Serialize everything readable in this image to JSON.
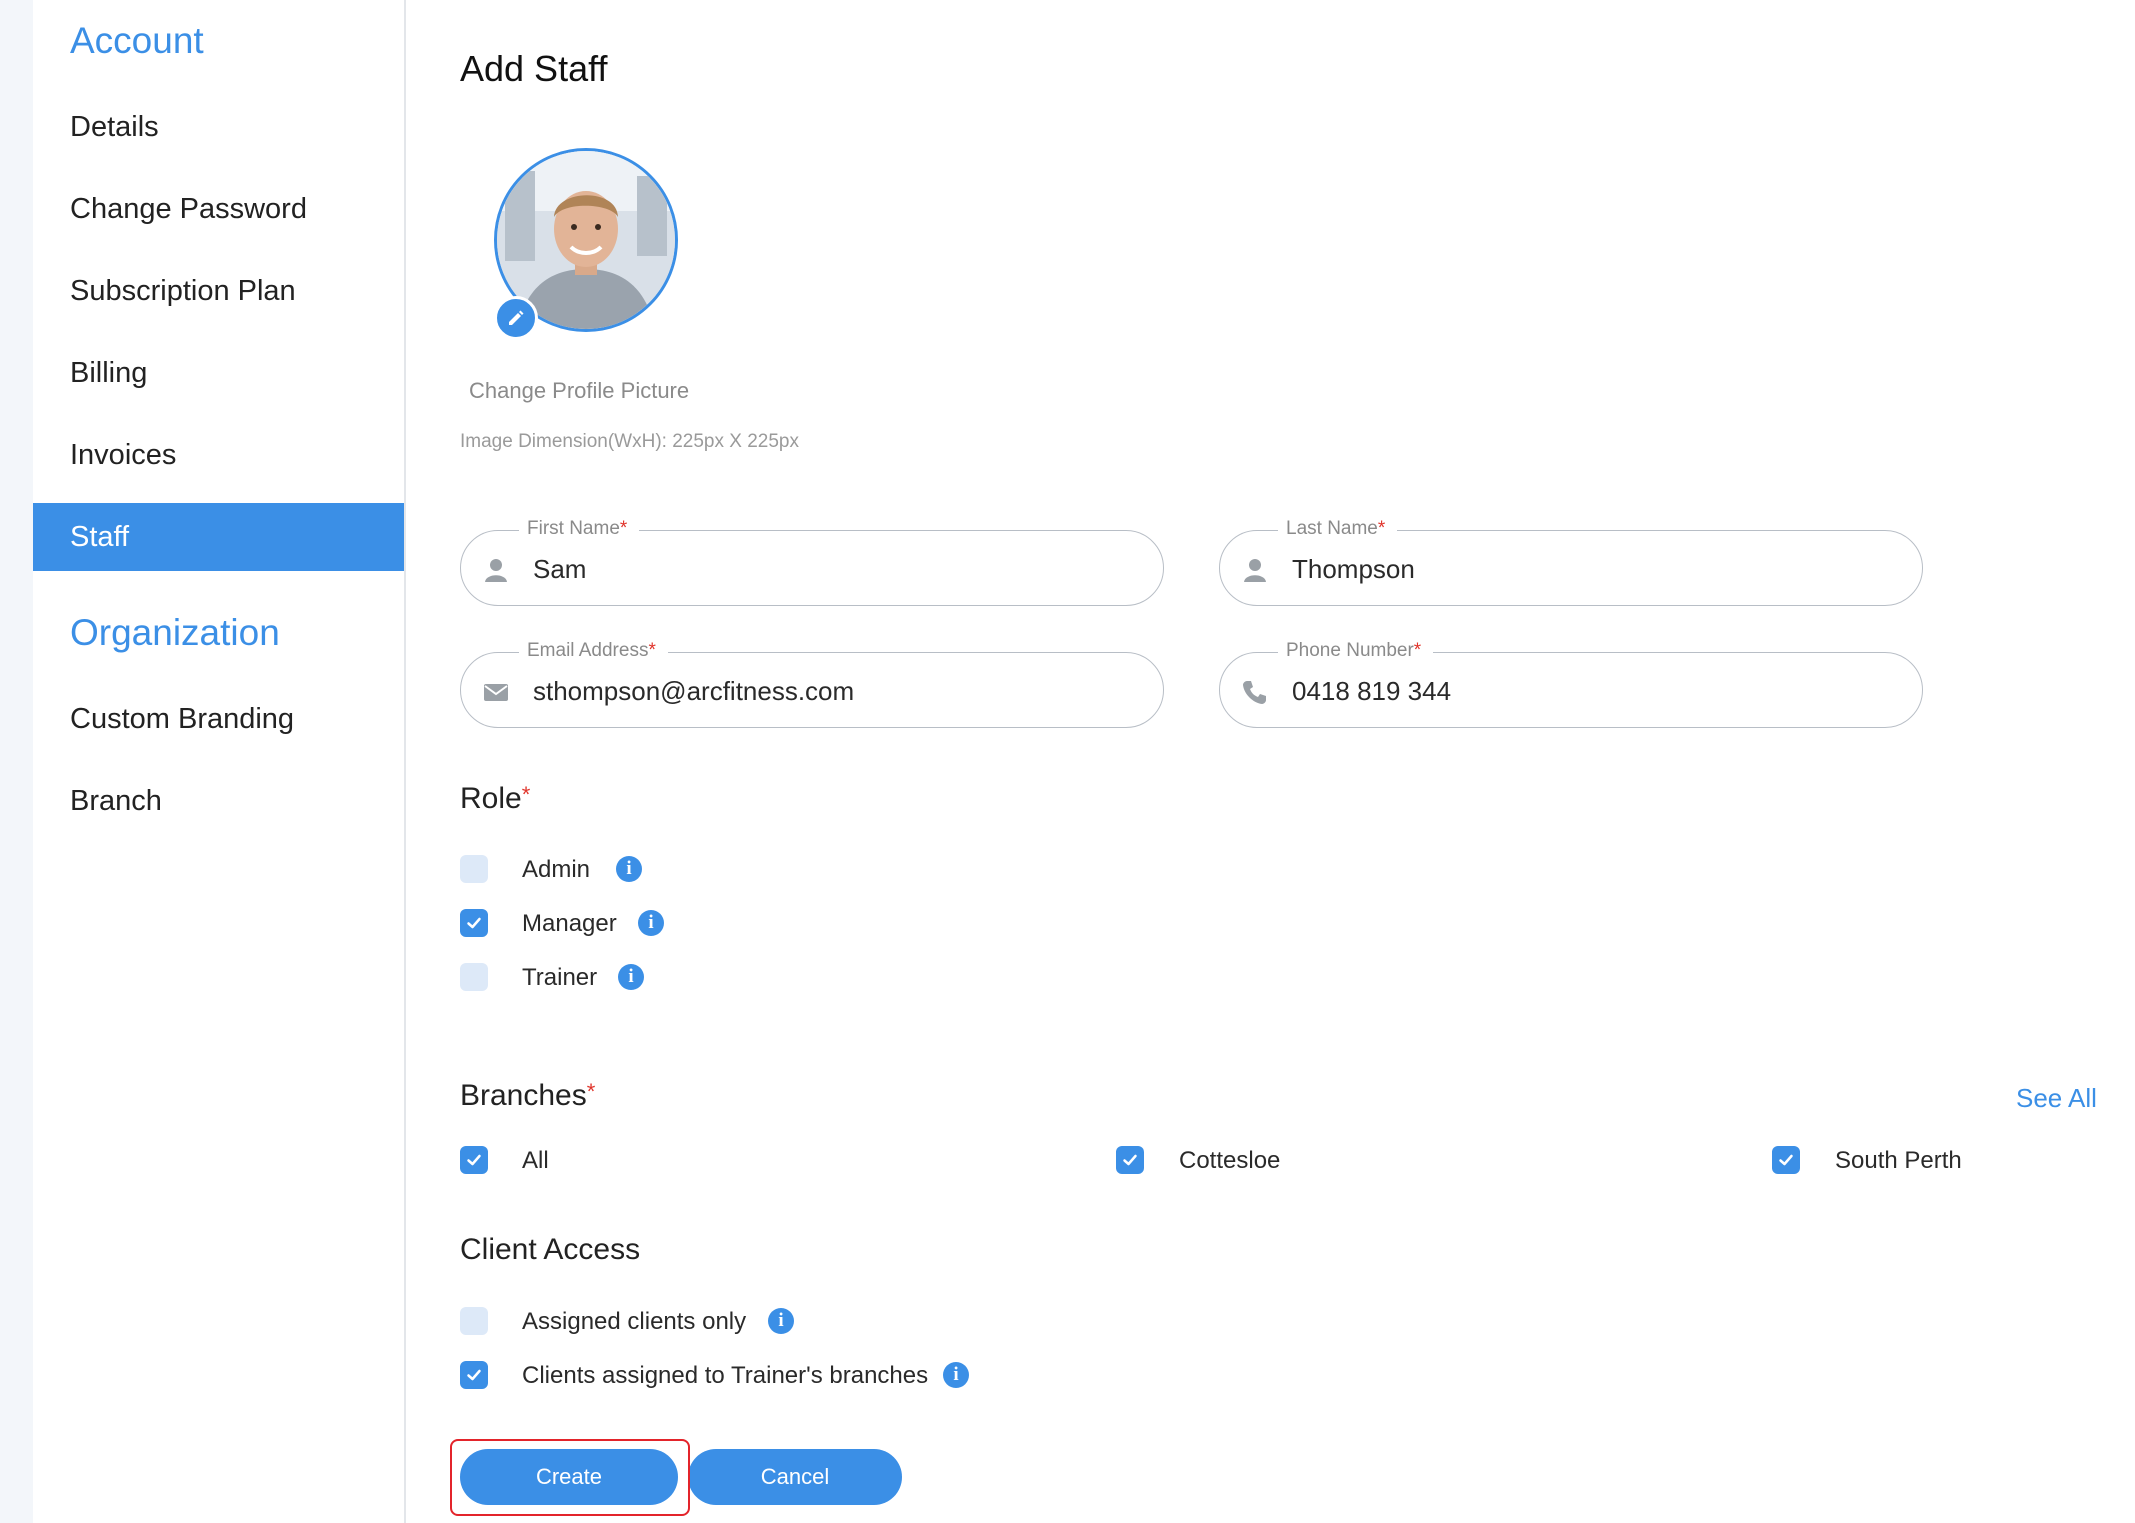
{
  "sidebar": {
    "account_heading": "Account",
    "items": [
      {
        "label": "Details"
      },
      {
        "label": "Change Password"
      },
      {
        "label": "Subscription Plan"
      },
      {
        "label": "Billing"
      },
      {
        "label": "Invoices"
      },
      {
        "label": "Staff",
        "active": true
      }
    ],
    "organization_heading": "Organization",
    "org_items": [
      {
        "label": "Custom Branding"
      },
      {
        "label": "Branch"
      }
    ]
  },
  "main": {
    "title": "Add Staff",
    "profile": {
      "change_label": "Change Profile Picture",
      "dimension_note": "Image Dimension(WxH): 225px X 225px"
    },
    "fields": {
      "first_name": {
        "label": "First Name",
        "value": "Sam"
      },
      "last_name": {
        "label": "Last Name",
        "value": "Thompson"
      },
      "email": {
        "label": "Email Address",
        "value": "sthompson@arcfitness.com"
      },
      "phone": {
        "label": "Phone Number",
        "value": "0418 819 344"
      }
    },
    "required_mark": "*",
    "role": {
      "title": "Role",
      "options": [
        {
          "label": "Admin",
          "checked": false
        },
        {
          "label": "Manager",
          "checked": true
        },
        {
          "label": "Trainer",
          "checked": false
        }
      ]
    },
    "branches": {
      "title": "Branches",
      "see_all": "See All",
      "options": [
        {
          "label": "All",
          "checked": true
        },
        {
          "label": "Cottesloe",
          "checked": true
        },
        {
          "label": "South Perth",
          "checked": true
        }
      ]
    },
    "client_access": {
      "title": "Client Access",
      "options": [
        {
          "label": "Assigned clients only",
          "checked": false
        },
        {
          "label": "Clients assigned to Trainer's branches",
          "checked": true
        }
      ]
    },
    "buttons": {
      "create": "Create",
      "cancel": "Cancel"
    },
    "info_glyph": "i"
  },
  "colors": {
    "accent": "#3b8fe6",
    "required": "#e0342b",
    "highlight": "#e3242b",
    "checkbox_off": "#dde9f8"
  },
  "icons": [
    "edit-pencil-icon",
    "user-icon",
    "mail-icon",
    "phone-icon",
    "info-icon",
    "checkmark-icon"
  ]
}
